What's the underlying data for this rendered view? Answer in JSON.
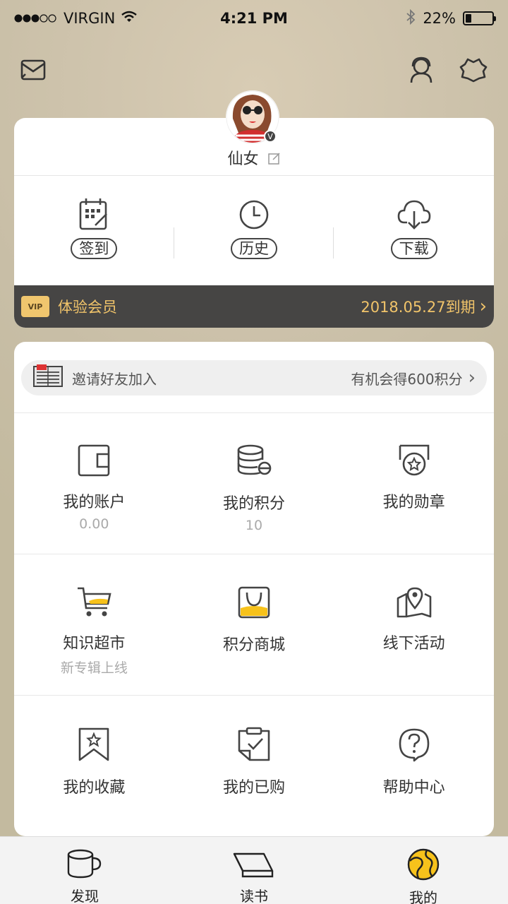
{
  "status": {
    "carrier": "VIRGIN",
    "time": "4:21 PM",
    "battery_text": "22%",
    "battery_level": 0.22
  },
  "header": {
    "mail_icon": "mail-icon",
    "profile_icon": "user-headset-icon",
    "settings_icon": "settings-icon"
  },
  "profile": {
    "nickname": "仙女",
    "badge": "V",
    "quick": [
      {
        "label": "签到",
        "icon": "calendar-checkin-icon"
      },
      {
        "label": "历史",
        "icon": "clock-icon"
      },
      {
        "label": "下载",
        "icon": "cloud-download-icon"
      }
    ],
    "vip": {
      "badge": "VIP",
      "label": "体验会员",
      "expiry": "2018.05.27到期",
      "arrow": "›"
    }
  },
  "invite": {
    "label": "邀请好友加入",
    "reward": "有机会得600积分",
    "arrow": "›"
  },
  "grid": [
    [
      {
        "label": "我的账户",
        "sub": "0.00",
        "icon": "wallet-icon"
      },
      {
        "label": "我的积分",
        "sub": "10",
        "icon": "coins-icon"
      },
      {
        "label": "我的勋章",
        "sub": "",
        "icon": "medal-icon"
      }
    ],
    [
      {
        "label": "知识超市",
        "sub": "新专辑上线",
        "icon": "cart-icon"
      },
      {
        "label": "积分商城",
        "sub": "",
        "icon": "shopping-bag-icon"
      },
      {
        "label": "线下活动",
        "sub": "",
        "icon": "map-pin-icon"
      }
    ],
    [
      {
        "label": "我的收藏",
        "sub": "",
        "icon": "bookmark-star-icon"
      },
      {
        "label": "我的已购",
        "sub": "",
        "icon": "clipboard-check-icon"
      },
      {
        "label": "帮助中心",
        "sub": "",
        "icon": "help-icon"
      }
    ]
  ],
  "tabs": [
    {
      "label": "发现",
      "icon": "cup-icon"
    },
    {
      "label": "读书",
      "icon": "book-icon"
    },
    {
      "label": "我的",
      "icon": "globe-icon"
    }
  ],
  "colors": {
    "accent": "#f7c21b",
    "vip_text": "#f1c46a",
    "vip_bar": "#464544"
  }
}
